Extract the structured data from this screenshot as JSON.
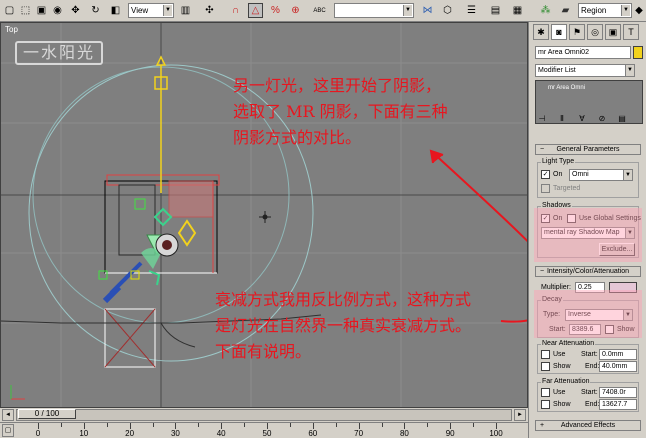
{
  "toolbar": {
    "view_select": "View",
    "region_select": "Region",
    "abc_label": "ABC",
    "icons": [
      "select-region-rect-icon",
      "window-crossing-icon",
      "select-move-icon",
      "select-rotate-icon",
      "select-scale-icon",
      "ref-coord-view",
      "use-pivot-icon",
      "mirror-icon",
      "snap-icon",
      "angle-snap-icon",
      "percent-snap-icon",
      "spinner-snap-icon",
      "named-selection",
      "mirror-tool-icon",
      "align-icon",
      "layer-icon",
      "curve-editor-icon",
      "schematic-icon",
      "material-editor-icon",
      "render-setup-icon",
      "quick-render-icon"
    ]
  },
  "viewport": {
    "label": "Top",
    "watermark": "一水阳光",
    "note1": [
      "另一灯光，这里开始了阴影，",
      "选取了 MR 阴影，下面有三种",
      "阴影方式的对比。"
    ],
    "note2": [
      "衰减方式我用反比例方式，这种方式",
      "是灯光在自然界一种真实衰减方式。",
      "下面有说明。"
    ],
    "note_color": "#e8161f"
  },
  "timeline": {
    "frame_label": "0 / 100",
    "ruler_labels": [
      "0",
      "10",
      "20",
      "30",
      "40",
      "50",
      "60",
      "70",
      "80",
      "90",
      "100"
    ]
  },
  "panel": {
    "object_name": "mr Area Omni02",
    "object_color": "#f2d21d",
    "modifier_list": "Modifier List",
    "stack_item": "mr Area Omni",
    "general": {
      "title": "General Parameters",
      "light_type_label": "Light Type",
      "on_label": "On",
      "type_value": "Omni",
      "targeted_label": "Targeted",
      "shadows_label": "Shadows",
      "shadows_on_label": "On",
      "use_global_label": "Use Global Settings",
      "shadow_type": "mental ray Shadow Map",
      "exclude_label": "Exclude..."
    },
    "intensity": {
      "title": "Intensity/Color/Attenuation",
      "multiplier_label": "Multiplier:",
      "multiplier_value": "0.25",
      "color": "#e4c7d6",
      "decay_label": "Decay",
      "type_label": "Type:",
      "type_value": "Inverse",
      "start_label": "Start:",
      "start_value": "8389.6",
      "show_label": "Show",
      "near_label": "Near Attenuation",
      "near_use": "Use",
      "near_show": "Show",
      "near_start_label": "Start:",
      "near_start_value": "0.0mm",
      "near_end_label": "End:",
      "near_end_value": "40.0mm",
      "far_label": "Far Attenuation",
      "far_use": "Use",
      "far_show": "Show",
      "far_start_label": "Start:",
      "far_start_value": "7408.0r",
      "far_end_label": "End:",
      "far_end_value": "13627.7"
    },
    "advanced_title": "Advanced Effects"
  }
}
